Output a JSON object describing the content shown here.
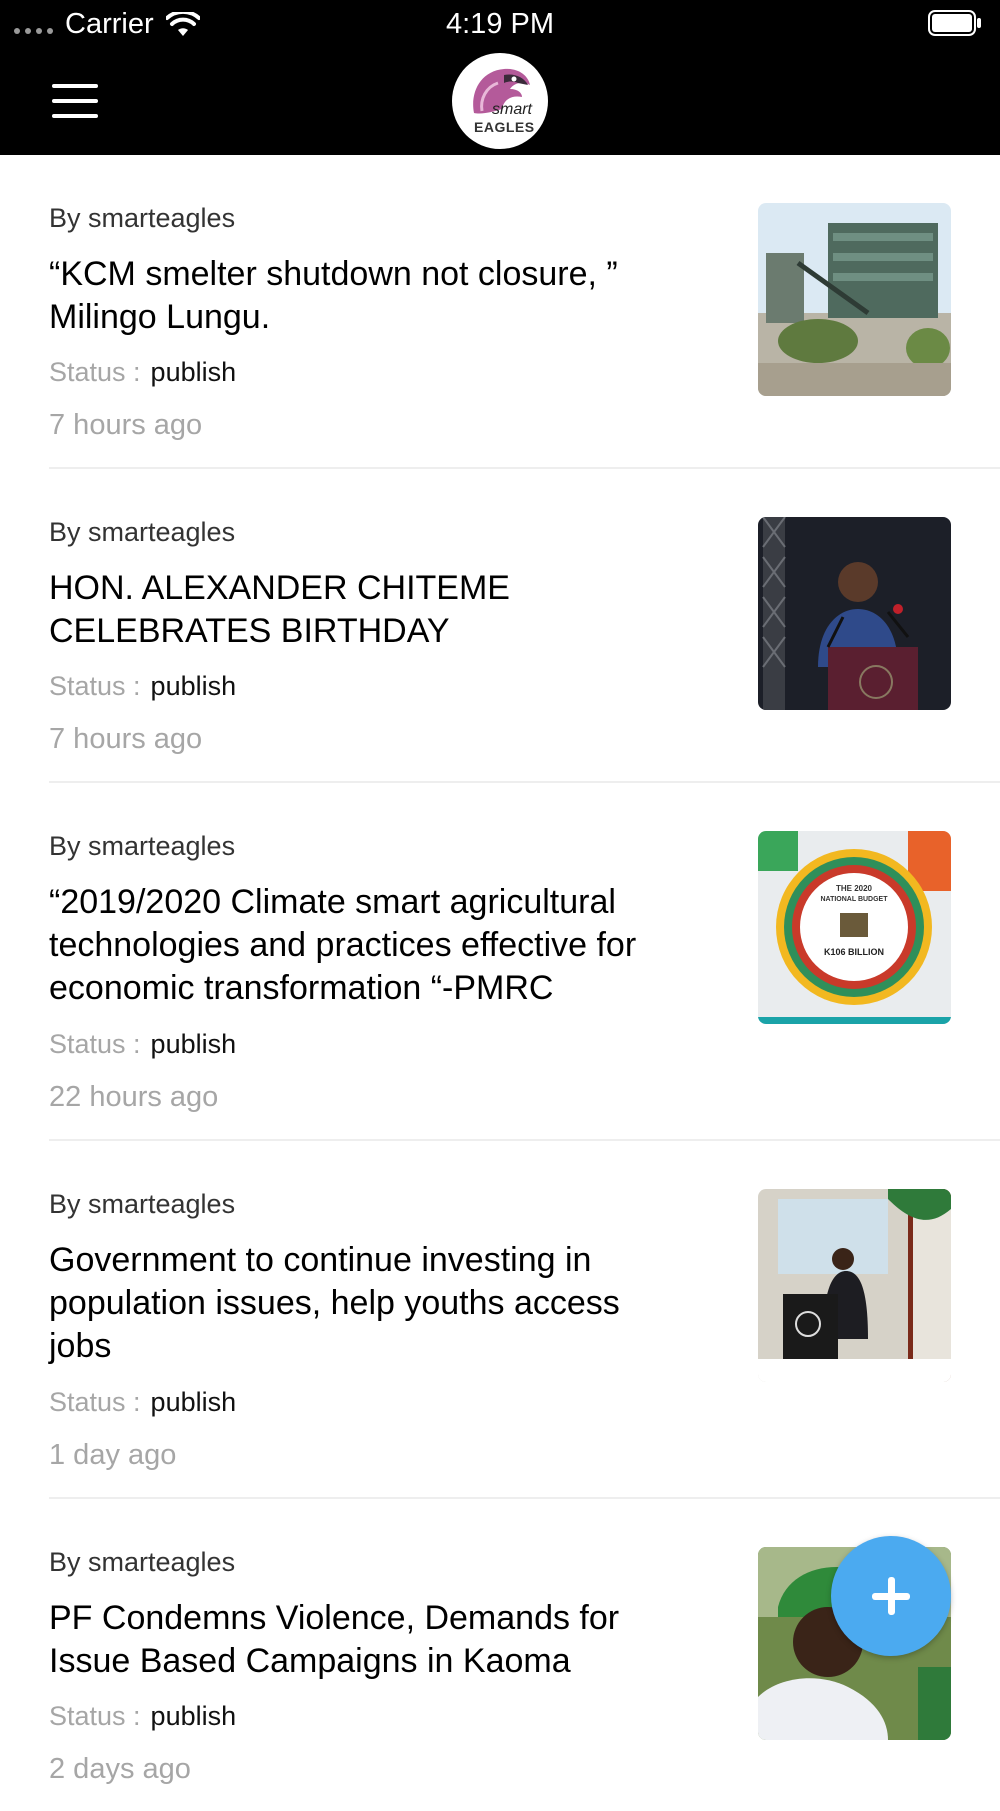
{
  "status_bar": {
    "carrier": "Carrier",
    "time": "4:19 PM"
  },
  "header": {
    "logo_line1": "smart",
    "logo_line2": "EAGLES"
  },
  "posts": [
    {
      "author": "By smarteagles",
      "title_lines": [
        "“KCM smelter shutdown not closure, ”",
        "Milingo Lungu."
      ],
      "status_label": "Status :",
      "status_value": "publish",
      "time": "7 hours ago"
    },
    {
      "author": "By smarteagles",
      "title_lines": [
        "HON. ALEXANDER CHITEME",
        "CELEBRATES BIRTHDAY"
      ],
      "status_label": "Status :",
      "status_value": "publish",
      "time": "7 hours ago"
    },
    {
      "author": "By smarteagles",
      "title_lines": [
        "“2019/2020 Climate smart agricultural",
        "technologies and practices effective for",
        "economic transformation “-PMRC"
      ],
      "status_label": "Status :",
      "status_value": "publish",
      "time": "22 hours ago"
    },
    {
      "author": "By smarteagles",
      "title_lines": [
        "Government to continue investing in",
        "population issues, help youths access",
        "jobs"
      ],
      "status_label": "Status :",
      "status_value": "publish",
      "time": "1 day ago"
    },
    {
      "author": "By smarteagles",
      "title_lines": [
        "PF Condemns Violence, Demands for",
        "Issue Based Campaigns in Kaoma"
      ],
      "status_label": "Status :",
      "status_value": "publish",
      "time": "2 days ago"
    }
  ],
  "thumb3": {
    "line1": "THE 2020",
    "line2": "NATIONAL BUDGET",
    "line3": "K106 BILLION"
  },
  "colors": {
    "header_bg": "#000000",
    "fab": "#4baaf0",
    "muted_text": "#a6a6a6",
    "divider": "#eeeeee"
  },
  "icons": {
    "menu": "hamburger-icon",
    "fab": "plus-icon"
  }
}
